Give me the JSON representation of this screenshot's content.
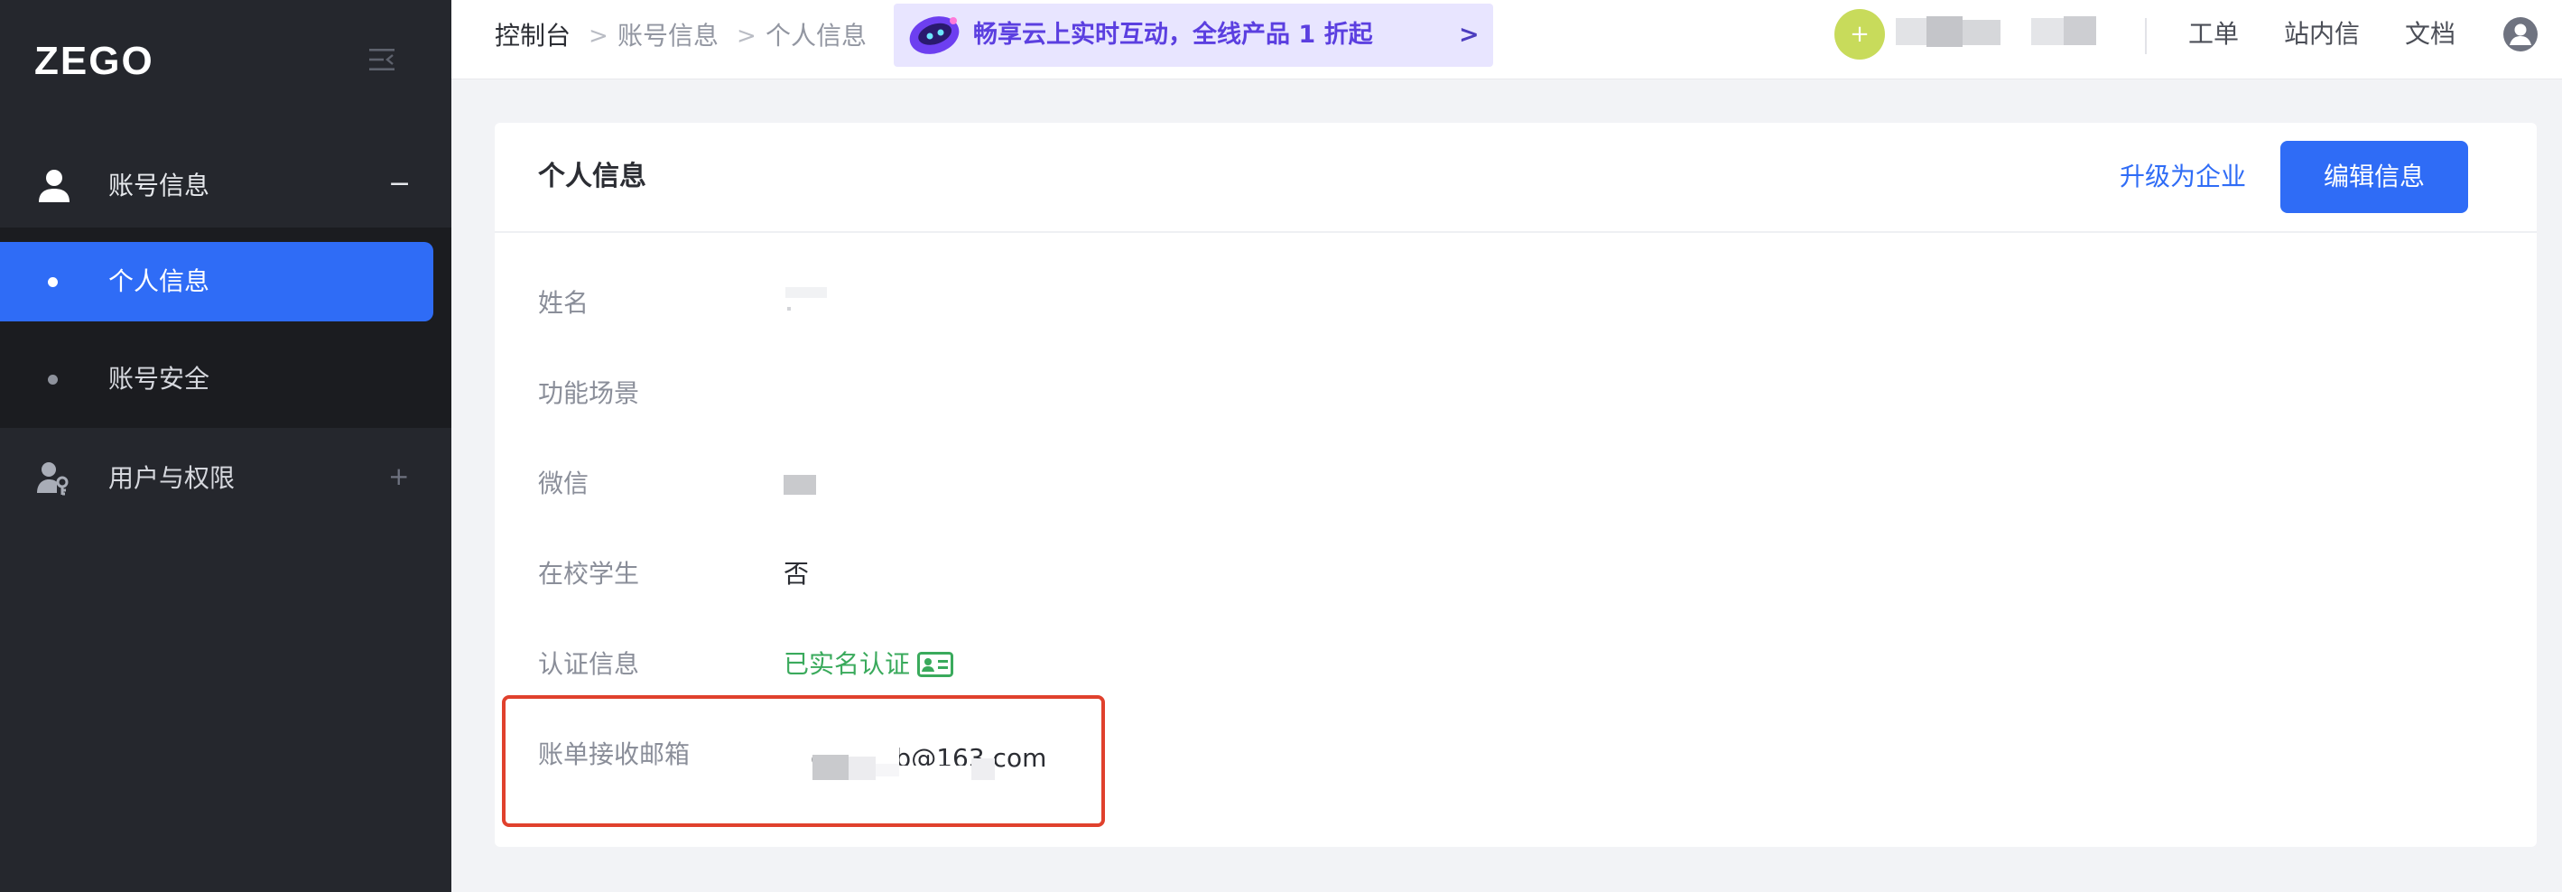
{
  "app": {
    "logo_text": "ZEGO"
  },
  "sidebar": {
    "groups": [
      {
        "label": "账号信息",
        "toggle": "−",
        "icon": "user-icon"
      },
      {
        "label": "用户与权限",
        "toggle": "+",
        "icon": "user-key-icon"
      }
    ],
    "items": [
      {
        "label": "个人信息",
        "active": true
      },
      {
        "label": "账号安全",
        "active": false
      }
    ]
  },
  "header": {
    "breadcrumb": [
      "控制台",
      "账号信息",
      "个人信息"
    ],
    "breadcrumb_separator": ">",
    "promo_text": "畅享云上实时互动，全线产品 1 折起",
    "promo_arrow": ">",
    "add_button": "+",
    "links": [
      "工单",
      "站内信",
      "文档"
    ]
  },
  "card": {
    "title": "个人信息",
    "upgrade_link": "升级为企业",
    "edit_button": "编辑信息",
    "fields": [
      {
        "label": "姓名",
        "value": ""
      },
      {
        "label": "功能场景",
        "value": ""
      },
      {
        "label": "微信",
        "value": ""
      },
      {
        "label": "在校学生",
        "value": "否"
      },
      {
        "label": "认证信息",
        "value": "已实名认证"
      },
      {
        "label": "账单接收邮箱",
        "value": "ge_amb@163.com"
      }
    ]
  },
  "colors": {
    "sidebar_bg": "#25272d",
    "submenu_bg": "#1b1c20",
    "accent": "#2f6cf6",
    "verified_green": "#3aaa5c",
    "promo_bg": "#e8e5ff",
    "promo_text": "#5b3fe0",
    "highlight_red": "#e0412d"
  }
}
